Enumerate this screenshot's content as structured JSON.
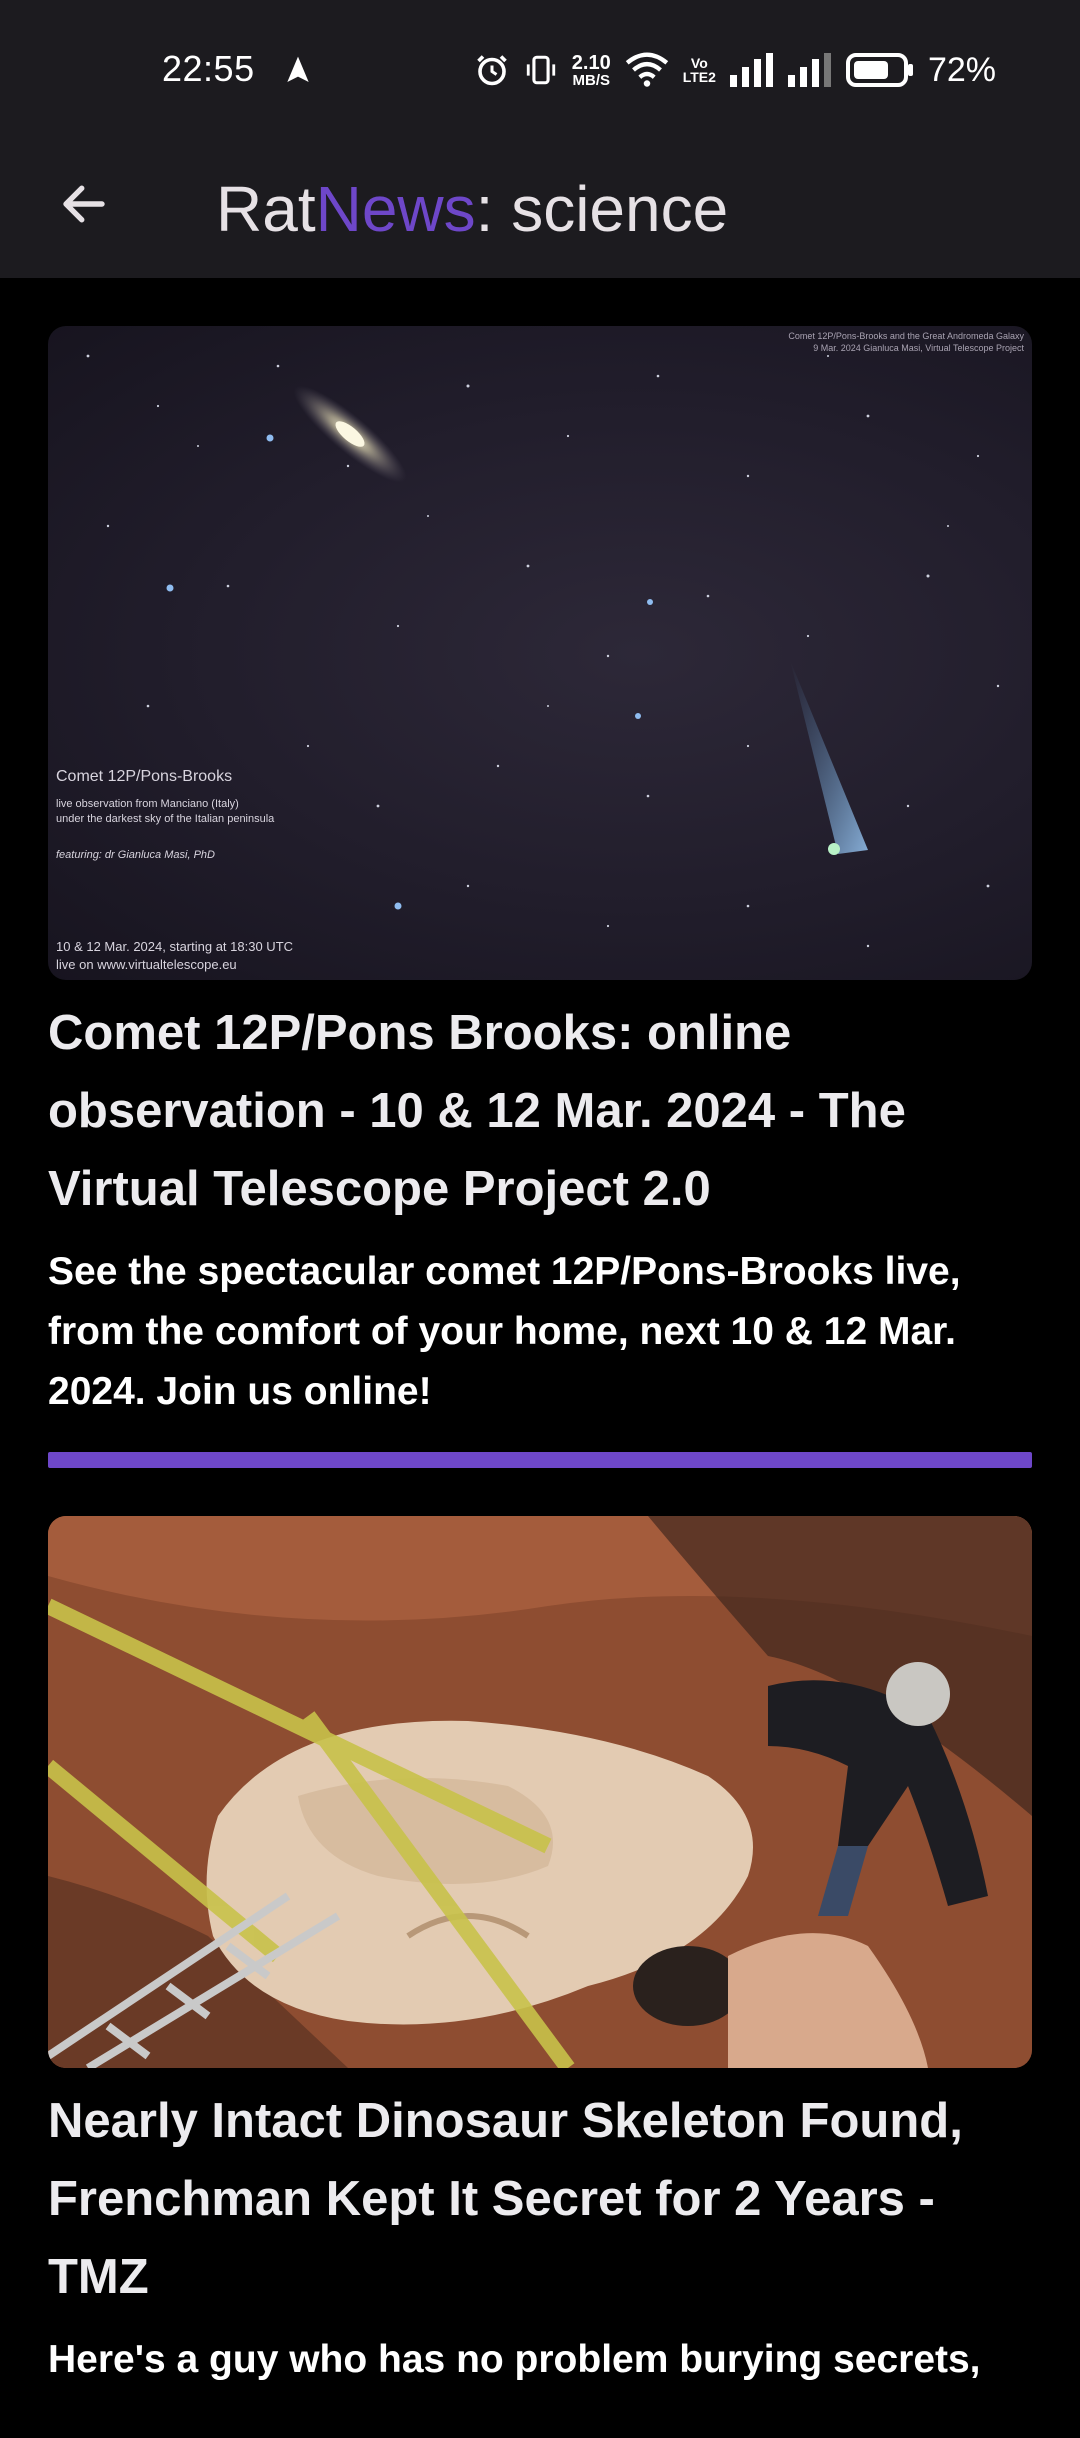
{
  "status_bar": {
    "time": "22:55",
    "net_speed_value": "2.10",
    "net_speed_unit": "MB/S",
    "volte_top": "Vo",
    "volte_bottom": "LTE2",
    "battery": "72%",
    "icons": [
      "navigation-icon",
      "alarm-icon",
      "vibrate-icon",
      "wifi-icon",
      "signal-icon",
      "signal-icon-2",
      "battery-icon"
    ]
  },
  "app_bar": {
    "title_part1": "Rat",
    "title_part2": "News",
    "title_part3": ": science",
    "back_icon": "arrow-left-icon",
    "theme_icon": "moon-icon"
  },
  "colors": {
    "accent": "#6e47c9",
    "bar_bg": "#1c1b1f",
    "page_bg": "#000000"
  },
  "articles": [
    {
      "image_overlay": {
        "top_credit_1": "Comet 12P/Pons-Brooks and the Great Andromeda Galaxy",
        "top_credit_2": "9 Mar. 2024 Gianluca Masi, Virtual Telescope Project",
        "heading": "Comet 12P/Pons-Brooks",
        "line1": "live observation from Manciano (Italy)",
        "line2": "under the darkest sky of the Italian peninsula",
        "featuring": "featuring: dr Gianluca Masi, PhD",
        "date_line": "10 & 12  Mar. 2024, starting at 18:30 UTC",
        "url_line": "live on www.virtualtelescope.eu"
      },
      "title": "Comet 12P/Pons Brooks: online observation - 10 & 12 Mar. 2024 - The Virtual Telescope Project 2.0",
      "description": "See the spectacular comet 12P/Pons-Brooks live, from the comfort of your home, next 10 & 12 Mar. 2024. Join us online!"
    },
    {
      "title": "Nearly Intact Dinosaur Skeleton Found, Frenchman Kept It Secret for 2 Years - TMZ",
      "description": "Here's a guy who has no problem burying secrets,"
    }
  ]
}
